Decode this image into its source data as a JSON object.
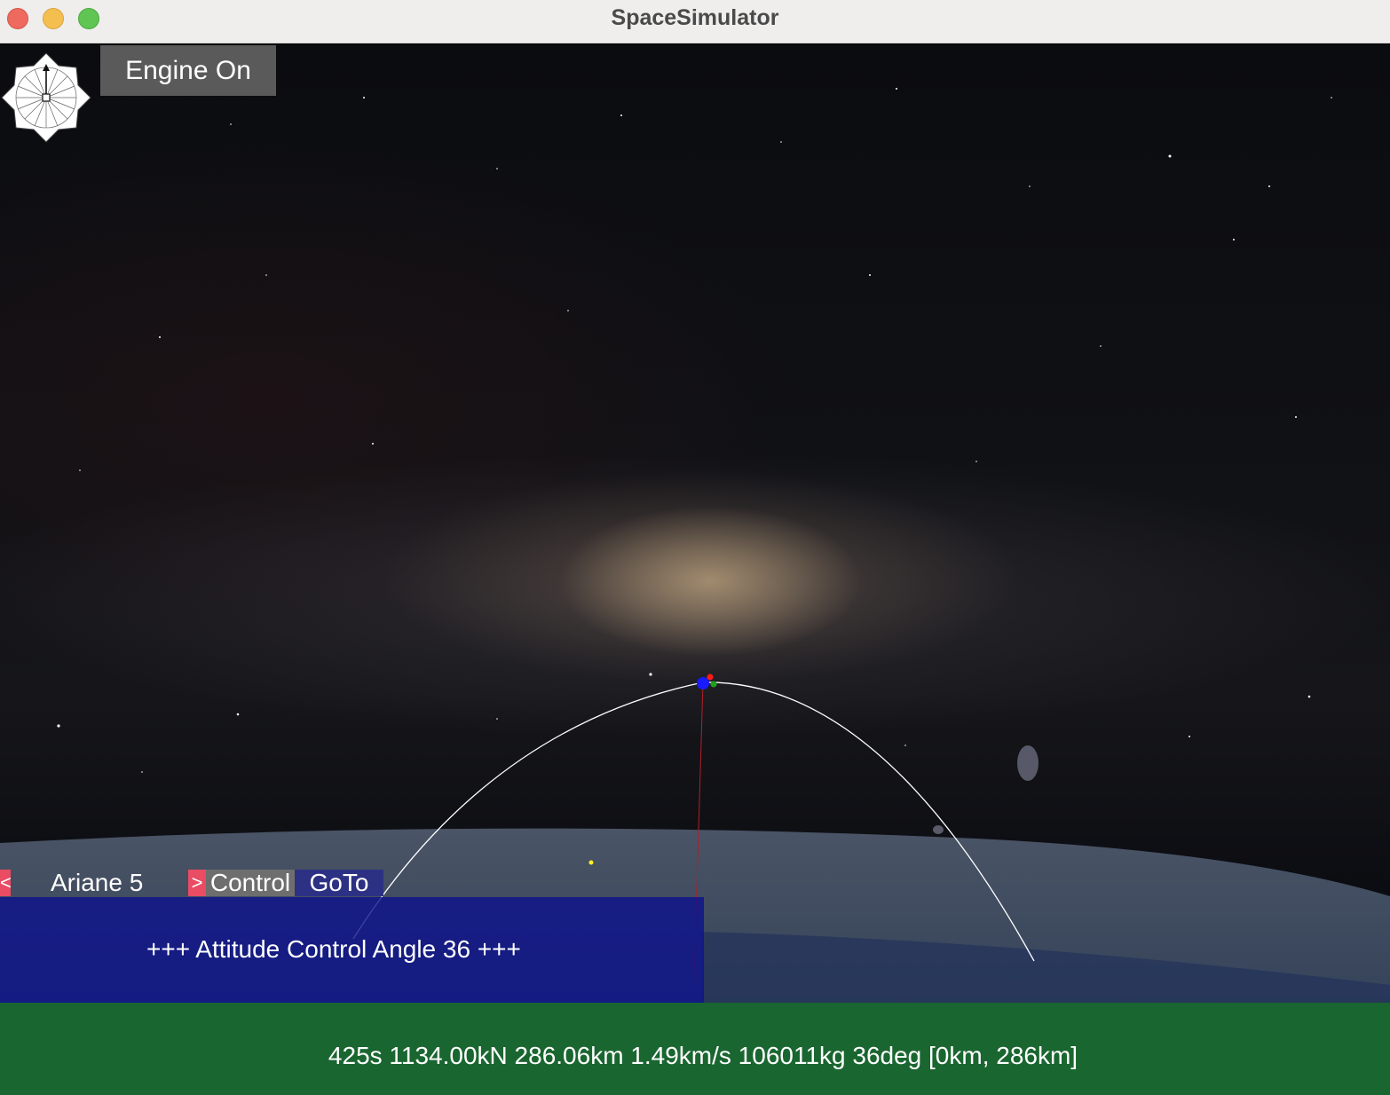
{
  "window": {
    "title": "SpaceSimulator"
  },
  "controls": {
    "engine_button": "Engine On"
  },
  "menu": {
    "prev_arrow": "<",
    "vehicle": "Ariane 5",
    "selected_marker": ">",
    "items": [
      "Control",
      "GoTo"
    ],
    "selected": "Control"
  },
  "message": "+++ Attitude Control Angle 36 +++",
  "status": "425s 1134.00kN 286.06km 1.49km/s 106011kg 36deg [0km, 286km]",
  "colors": {
    "status_bar": "#1a6630",
    "message_panel": "#0c128c",
    "menu_highlight": "#e94c63",
    "menu_selected": "#6e6e6e",
    "menu_item": "#2d3183",
    "trajectory": "#ffffff"
  },
  "icons": {
    "compass": "compass-rose-icon"
  }
}
